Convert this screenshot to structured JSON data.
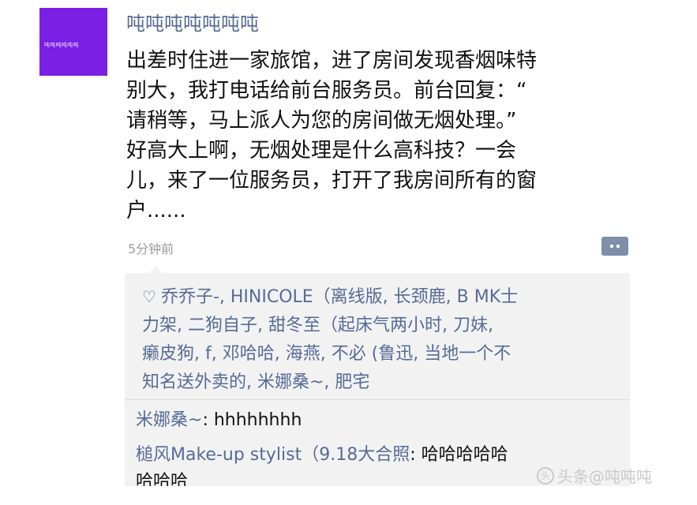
{
  "post": {
    "username": "吨吨吨吨吨吨吨",
    "avatar_text": "吨吨吨吨吨吨",
    "text_lines": [
      "出差时住进一家旅馆，进了房间发现香烟味特",
      "别大，我打电话给前台服务员。前台回复：“",
      "请稍等，马上派人为您的房间做无烟处理。”",
      "好高大上啊，无烟处理是什么高科技？一会",
      "儿，来了一位服务员，打开了我房间所有的窗",
      "户......"
    ],
    "time": "5分钟前",
    "comment_icon": "comment-bubble-icon"
  },
  "likes": {
    "heart_icon": "♡",
    "lines": [
      "乔乔子-, HINICOLE（离线版, 长颈鹿, B MK士",
      "力架, 二狗自子, 甜冬至（起床气两小时, 刀妹,",
      "癞皮狗, f, 邓哈哈, 海燕, 不必 (鲁迅, 当地一个不",
      "知名送外卖的, 米娜桑~, 肥宅"
    ]
  },
  "comments": [
    {
      "name": "米娜桑~",
      "text": ": hhhhhhhh"
    },
    {
      "name": "槌风Make-up stylist（9.18大合照",
      "text": ": 哈哈哈哈哈",
      "cont": "哈哈哈"
    }
  ],
  "watermark": {
    "logo": "头",
    "text": "头条@吨吨吨"
  },
  "colors": {
    "link": "#576b95",
    "avatar": "#7a1fe3",
    "panel": "#f2f2f3"
  }
}
